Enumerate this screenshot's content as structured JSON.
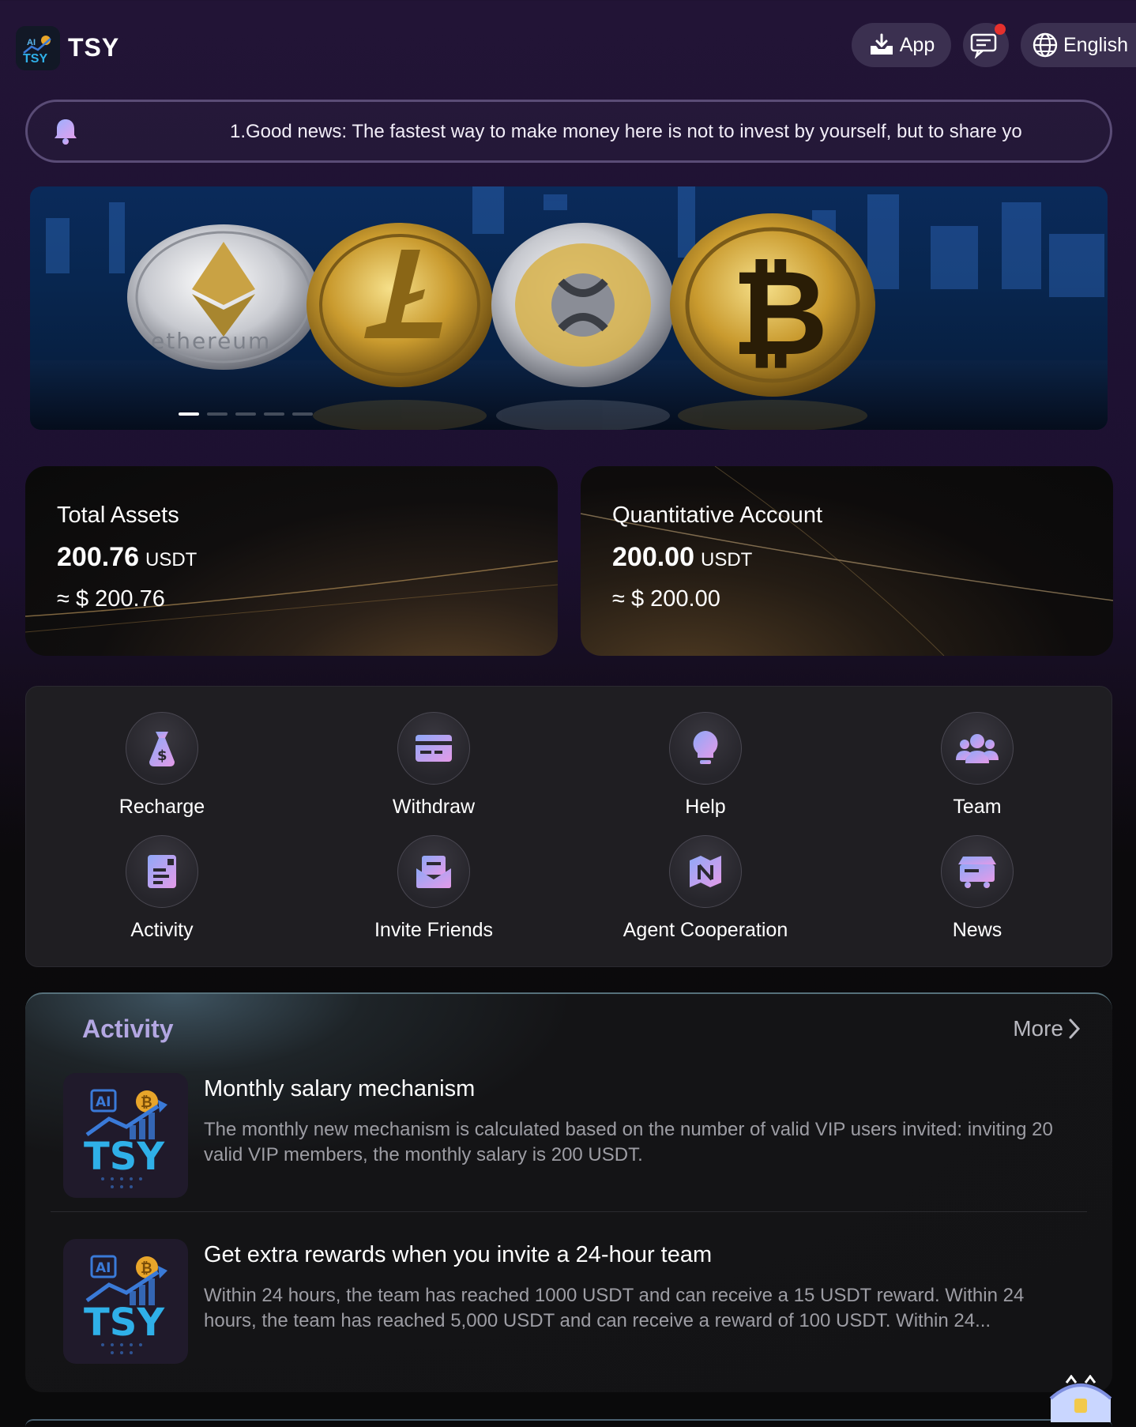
{
  "header": {
    "brand": "TSY",
    "app_label": "App",
    "language_label": "English"
  },
  "notice": {
    "text": "1.Good news: The fastest way to make money here is not to invest by yourself, but to share yo"
  },
  "banner": {
    "coin_text": "ethereum",
    "slides_count": 5,
    "active_slide": 1
  },
  "assets": {
    "total": {
      "label": "Total Assets",
      "amount": "200.76",
      "unit": "USDT",
      "approx": "≈ $ 200.76"
    },
    "quant": {
      "label": "Quantitative Account",
      "amount": "200.00",
      "unit": "USDT",
      "approx": "≈ $ 200.00"
    }
  },
  "menu": {
    "items": [
      {
        "label": "Recharge",
        "icon": "money-bag-icon"
      },
      {
        "label": "Withdraw",
        "icon": "card-icon"
      },
      {
        "label": "Help",
        "icon": "lightbulb-icon"
      },
      {
        "label": "Team",
        "icon": "users-icon"
      },
      {
        "label": "Activity",
        "icon": "document-icon"
      },
      {
        "label": "Invite Friends",
        "icon": "envelope-icon"
      },
      {
        "label": "Agent Cooperation",
        "icon": "map-icon"
      },
      {
        "label": "News",
        "icon": "shop-icon"
      }
    ]
  },
  "activity": {
    "title": "Activity",
    "more_label": "More",
    "items": [
      {
        "title": "Monthly salary mechanism",
        "desc": "The monthly new mechanism is calculated based on the number of valid VIP users invited: inviting 20 valid VIP members, the monthly salary is 200 USDT."
      },
      {
        "title": "Get extra rewards when you invite a 24-hour team",
        "desc": "Within 24 hours, the team has reached 1000 USDT and can receive a 15 USDT reward. Within 24 hours, the team has reached 5,000 USDT and can receive a reward of 100 USDT. Within 24..."
      }
    ],
    "thumb_text": {
      "ai": "AI",
      "brand": "TSY",
      "coin": "₿"
    }
  },
  "colors": {
    "accent": "#b3a7e2",
    "icon_gradient_start": "#8fa8f8",
    "icon_gradient_end": "#e49be8",
    "notification_dot": "#e5302d"
  }
}
